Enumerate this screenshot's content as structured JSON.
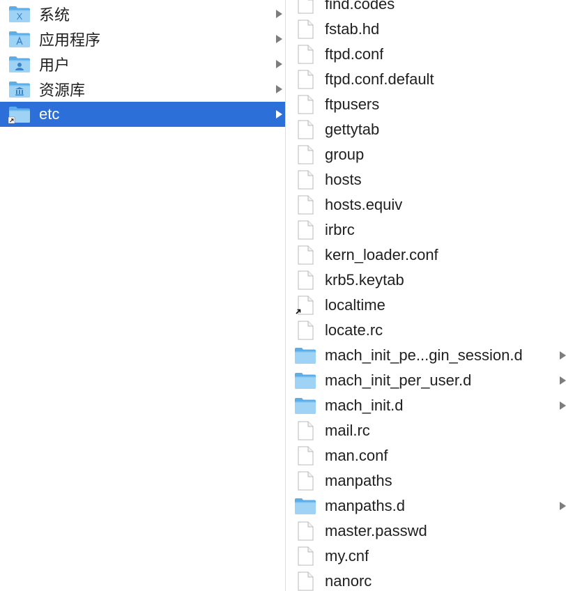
{
  "sidebar": {
    "items": [
      {
        "label": "系统",
        "icon": "system-folder-icon",
        "glyph": "X"
      },
      {
        "label": "应用程序",
        "icon": "applications-folder-icon",
        "glyph": "A"
      },
      {
        "label": "用户",
        "icon": "users-folder-icon",
        "glyph": "user"
      },
      {
        "label": "资源库",
        "icon": "library-folder-icon",
        "glyph": "library"
      },
      {
        "label": "etc",
        "icon": "alias-folder-icon",
        "selected": true
      }
    ]
  },
  "files": {
    "items": [
      {
        "label": "find.codes",
        "type": "file"
      },
      {
        "label": "fstab.hd",
        "type": "file"
      },
      {
        "label": "ftpd.conf",
        "type": "file"
      },
      {
        "label": "ftpd.conf.default",
        "type": "file"
      },
      {
        "label": "ftpusers",
        "type": "file"
      },
      {
        "label": "gettytab",
        "type": "file"
      },
      {
        "label": "group",
        "type": "file"
      },
      {
        "label": "hosts",
        "type": "file"
      },
      {
        "label": "hosts.equiv",
        "type": "file"
      },
      {
        "label": "irbrc",
        "type": "file"
      },
      {
        "label": "kern_loader.conf",
        "type": "file"
      },
      {
        "label": "krb5.keytab",
        "type": "file"
      },
      {
        "label": "localtime",
        "type": "alias"
      },
      {
        "label": "locate.rc",
        "type": "file"
      },
      {
        "label": "mach_init_pe...gin_session.d",
        "type": "folder"
      },
      {
        "label": "mach_init_per_user.d",
        "type": "folder"
      },
      {
        "label": "mach_init.d",
        "type": "folder"
      },
      {
        "label": "mail.rc",
        "type": "file"
      },
      {
        "label": "man.conf",
        "type": "file"
      },
      {
        "label": "manpaths",
        "type": "file"
      },
      {
        "label": "manpaths.d",
        "type": "folder"
      },
      {
        "label": "master.passwd",
        "type": "file"
      },
      {
        "label": "my.cnf",
        "type": "file"
      },
      {
        "label": "nanorc",
        "type": "file"
      }
    ]
  },
  "colors": {
    "selection": "#2d6fd8",
    "folder_light": "#9fd3f6",
    "folder_dark": "#5aaeea",
    "arrow": "#7d7d7d"
  }
}
